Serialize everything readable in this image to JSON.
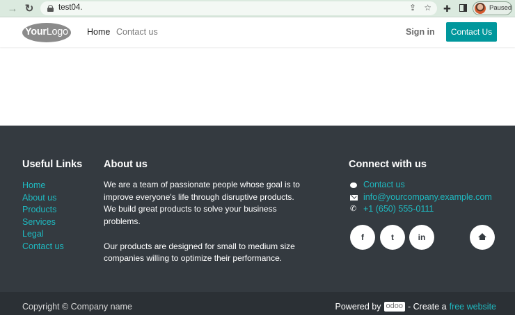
{
  "browser": {
    "url": "test04.",
    "profile_status": "Paused"
  },
  "header": {
    "logo_bold": "Your",
    "logo_light": "Logo",
    "nav": [
      {
        "label": "Home"
      },
      {
        "label": "Contact us"
      }
    ],
    "signin_label": "Sign in",
    "cta_label": "Contact Us"
  },
  "footer": {
    "useful_links": {
      "title": "Useful Links",
      "items": [
        "Home",
        "About us",
        "Products",
        "Services",
        "Legal",
        "Contact us"
      ]
    },
    "about": {
      "title": "About us",
      "paragraph1": "We are a team of passionate people whose goal is to improve everyone's life through disruptive products. We build great products to solve your business problems.",
      "paragraph2": "Our products are designed for small to medium size companies willing to optimize their performance."
    },
    "connect": {
      "title": "Connect with us",
      "contact_label": "Contact us",
      "email": "info@yourcompany.example.com",
      "phone": "+1 (650) 555-0111",
      "social": [
        {
          "glyph": "f",
          "icon": "facebook-icon"
        },
        {
          "glyph": "t",
          "icon": "twitter-icon"
        },
        {
          "glyph": "in",
          "icon": "linkedin-icon"
        },
        {
          "icon": "home-icon"
        }
      ]
    }
  },
  "copyright": {
    "left": "Copyright © Company name",
    "powered_by": "Powered by",
    "odoo": "odoo",
    "create_a": "- Create a",
    "free_website": "free website"
  },
  "colors": {
    "accent": "#00979c",
    "link": "#1fb9c0",
    "footer_bg": "#343a40",
    "copyright_bg": "#2b3035"
  }
}
